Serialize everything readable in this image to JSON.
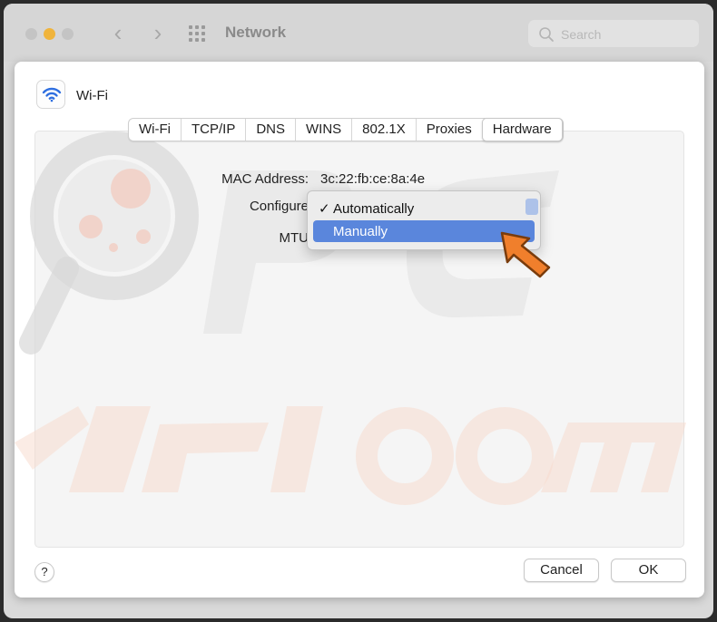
{
  "window": {
    "title": "Network",
    "search_placeholder": "Search",
    "accent_color": "#5a86dc",
    "minimize_color": "#f0b43c"
  },
  "sheet": {
    "service_name": "Wi-Fi",
    "service_icon": "wifi-icon",
    "tabs": [
      {
        "label": "Wi-Fi"
      },
      {
        "label": "TCP/IP"
      },
      {
        "label": "DNS"
      },
      {
        "label": "WINS"
      },
      {
        "label": "802.1X"
      },
      {
        "label": "Proxies"
      },
      {
        "label": "Hardware",
        "active": true
      }
    ],
    "hardware": {
      "mac_label": "MAC Address:",
      "mac_value": "3c:22:fb:ce:8a:4e",
      "configure_label": "Configure",
      "mtu_label": "MTU"
    },
    "configure_menu": {
      "options": [
        {
          "label": "Automatically",
          "checked": true,
          "check_mark": "✓"
        },
        {
          "label": "Manually",
          "highlighted": true
        }
      ]
    },
    "help_label": "?",
    "cancel_label": "Cancel",
    "ok_label": "OK"
  }
}
